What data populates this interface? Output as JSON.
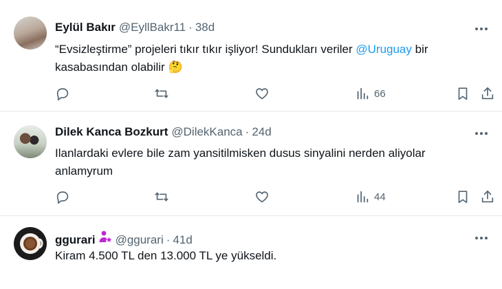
{
  "tweets": [
    {
      "name": "Eylül Bakır",
      "handle": "@EyllBakr11",
      "separator": "·",
      "time": "38d",
      "text_start": "“Evsizleştirme” projeleri tıkır tıkır işliyor!  Sundukları veriler ",
      "mention": "@Uruguay",
      "text_end": " bir kasabasından olabilir ",
      "emoji": "🤔",
      "views": "66"
    },
    {
      "name": "Dilek Kanca Bozkurt",
      "handle": "@DilekKanca",
      "separator": "·",
      "time": "24d",
      "text": "Ilanlardaki evlere bile zam yansitilmisken dusus sinyalini nerden aliyolar anlamyrum",
      "views": "44"
    },
    {
      "name": "ggurari",
      "handle": "@ggurari",
      "separator": "·",
      "time": "41d",
      "text": "Kiram 4.500 TL den 13.000 TL ye yükseldi."
    }
  ],
  "icons": {
    "more": "more-horizontal-icon",
    "reply": "reply-icon",
    "retweet": "retweet-icon",
    "like": "heart-icon",
    "views": "views-icon",
    "bookmark": "bookmark-icon",
    "share": "share-icon",
    "badge": "person-star-badge-icon"
  },
  "colors": {
    "text": "#0f1419",
    "secondary": "#536471",
    "link": "#1d9bf0",
    "badge": "#c026d3",
    "divider": "#e6e9ec"
  }
}
